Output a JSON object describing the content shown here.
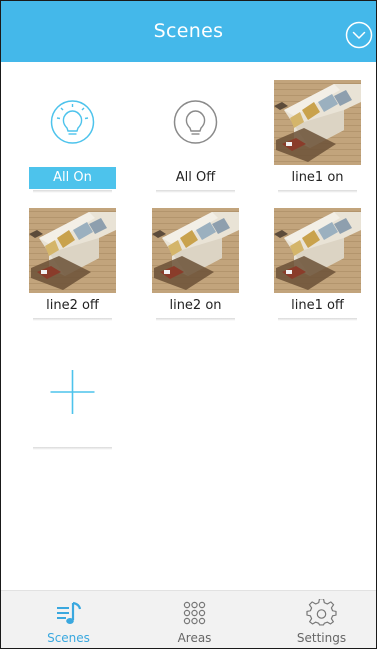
{
  "header": {
    "title": "Scenes",
    "action_icon": "chevron-down-circle-icon"
  },
  "scenes": [
    {
      "label": "All On",
      "icon": "lightbulb-on-icon",
      "active": true
    },
    {
      "label": "All Off",
      "icon": "lightbulb-off-icon",
      "active": false
    },
    {
      "label": "line1 on",
      "icon": "living-room-photo",
      "active": false
    },
    {
      "label": "line2 off",
      "icon": "living-room-photo",
      "active": false
    },
    {
      "label": "line2 on",
      "icon": "living-room-photo",
      "active": false
    },
    {
      "label": "line1 off",
      "icon": "living-room-photo",
      "active": false
    }
  ],
  "add_scene": {
    "icon": "plus-icon"
  },
  "tabs": [
    {
      "label": "Scenes",
      "icon": "scenes-icon",
      "active": true
    },
    {
      "label": "Areas",
      "icon": "areas-grid-icon",
      "active": false
    },
    {
      "label": "Settings",
      "icon": "settings-gear-icon",
      "active": false
    }
  ],
  "colors": {
    "brand": "#44b8ea",
    "active_label": "#4dc3ec",
    "tab_active": "#3aa8df",
    "tab_inactive": "#666666"
  }
}
